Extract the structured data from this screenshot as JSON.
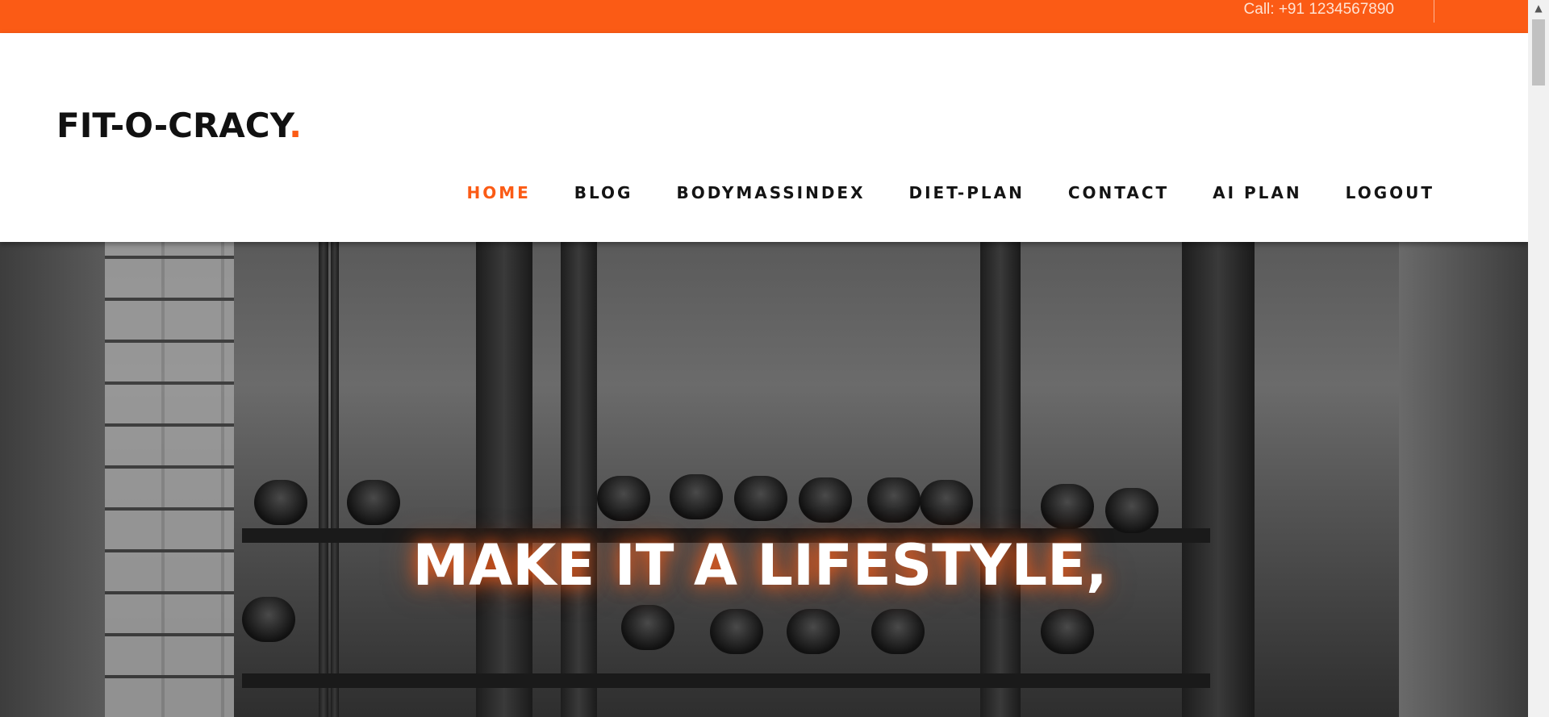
{
  "topbar": {
    "call_text": "Call: +91 1234567890",
    "color": "#fb5b15"
  },
  "logo": {
    "text": "FIT-O-CRACY",
    "dot": "."
  },
  "nav": {
    "items": [
      {
        "label": "HOME",
        "active": true
      },
      {
        "label": "BLOG"
      },
      {
        "label": "BODYMASSINDEX"
      },
      {
        "label": "DIET-PLAN"
      },
      {
        "label": "CONTACT"
      },
      {
        "label": "AI PLAN"
      },
      {
        "label": "LOGOUT"
      }
    ]
  },
  "hero": {
    "headline": "MAKE IT A LIFESTYLE,"
  },
  "scrollbar": {
    "up_icon": "chevron-up-icon"
  }
}
